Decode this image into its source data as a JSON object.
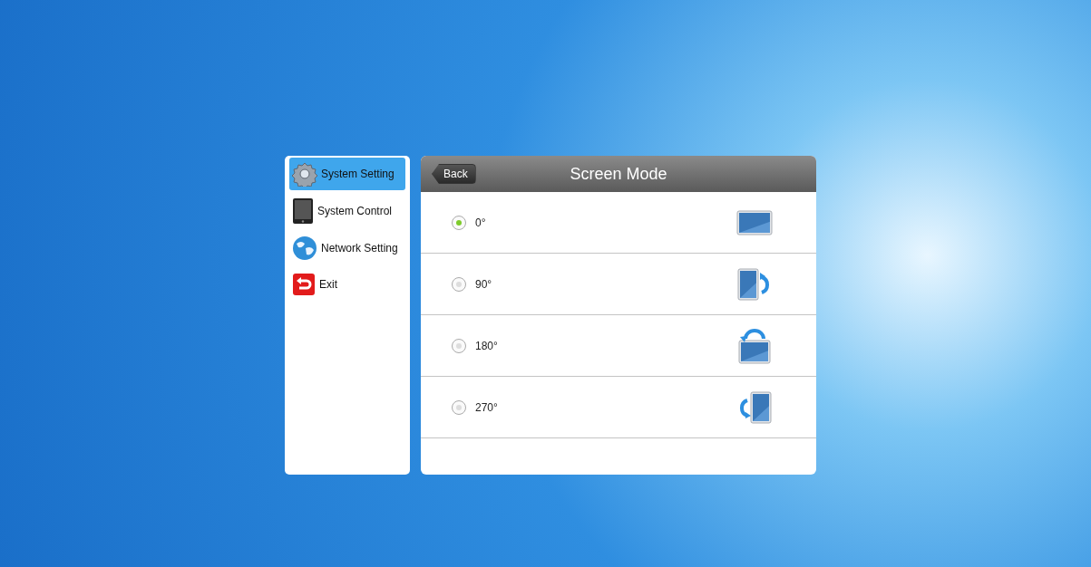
{
  "menu": {
    "items": [
      {
        "label": "System Setting",
        "kind": "gear",
        "selected": true
      },
      {
        "label": "System Control",
        "kind": "tablet",
        "selected": false
      },
      {
        "label": "Network Setting",
        "kind": "globe",
        "selected": false
      },
      {
        "label": "Exit",
        "kind": "exit",
        "selected": false
      }
    ]
  },
  "panel": {
    "back_button": "Back",
    "title": "Screen Mode",
    "options": [
      {
        "label": "0°",
        "kind": "landscape",
        "selected": true
      },
      {
        "label": "90°",
        "kind": "rotate-right",
        "selected": false
      },
      {
        "label": "180°",
        "kind": "rotate-top",
        "selected": false
      },
      {
        "label": "270°",
        "kind": "rotate-left",
        "selected": false
      }
    ]
  }
}
